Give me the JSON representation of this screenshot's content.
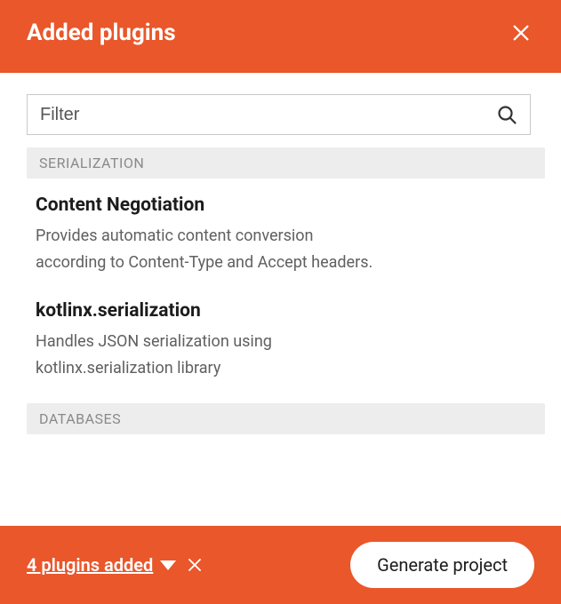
{
  "header": {
    "title": "Added plugins"
  },
  "filter": {
    "placeholder": "Filter"
  },
  "sections": [
    {
      "label": "SERIALIZATION",
      "items": [
        {
          "title": "Content Negotiation",
          "description": "Provides automatic content conversion according to Content-Type and Accept headers."
        },
        {
          "title": "kotlinx.serialization",
          "description": "Handles JSON serialization using kotlinx.serialization library"
        }
      ]
    },
    {
      "label": "DATABASES",
      "items": []
    }
  ],
  "footer": {
    "plugins_added": "4 plugins added",
    "generate": "Generate project"
  }
}
